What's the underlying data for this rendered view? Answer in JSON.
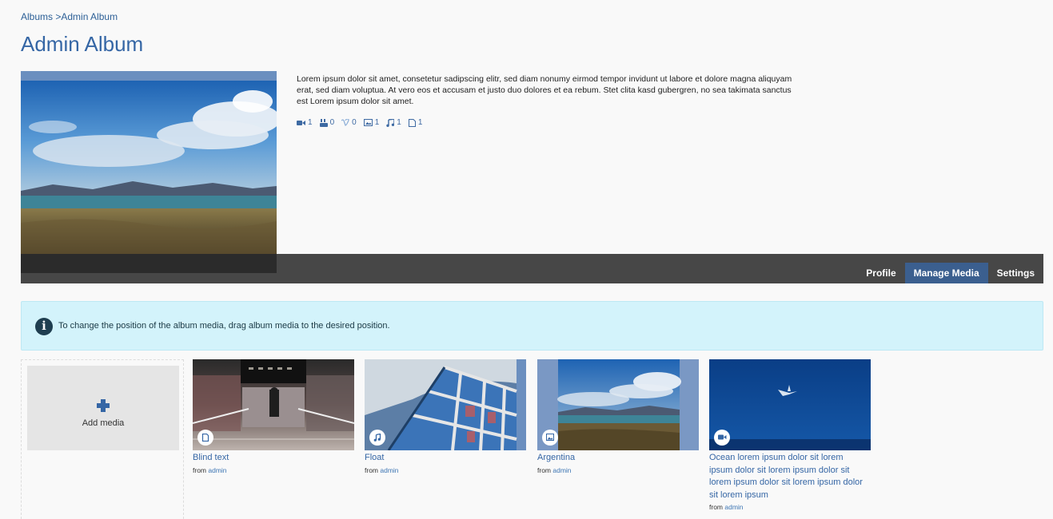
{
  "breadcrumb": {
    "albums_link": "Albums",
    "separator": " >",
    "current": "Admin Album"
  },
  "page_title": "Admin Album",
  "album": {
    "description": "Lorem ipsum dolor sit amet, consetetur sadipscing elitr, sed diam nonumy eirmod tempor invidunt ut labore et dolore magna aliquyam erat, sed diam voluptua. At vero eos et accusam et justo duo dolores et ea rebum. Stet clita kasd gubergren, no sea takimata sanctus est Lorem ipsum dolor sit amet.",
    "stats": {
      "video": "1",
      "youtube": "0",
      "vimeo": "0",
      "image": "1",
      "audio": "1",
      "document": "1"
    }
  },
  "tabs": [
    {
      "label": "Profile",
      "active": false
    },
    {
      "label": "Manage Media",
      "active": true
    },
    {
      "label": "Settings",
      "active": false
    }
  ],
  "alert": {
    "text": "To change the position of the album media, drag album media to the desired position."
  },
  "add_media": {
    "label": "Add media"
  },
  "media": [
    {
      "title": "Blind text",
      "from_label": "from",
      "author": "admin",
      "type_icon": "document-icon"
    },
    {
      "title": "Float",
      "from_label": "from",
      "author": "admin",
      "type_icon": "music-icon"
    },
    {
      "title": "Argentina",
      "from_label": "from",
      "author": "admin",
      "type_icon": "image-icon"
    },
    {
      "title": "Ocean lorem ipsum dolor sit lorem ipsum dolor sit lorem ipsum dolor sit lorem ipsum dolor sit lorem ipsum dolor sit lorem ipsum",
      "from_label": "from",
      "author": "admin",
      "type_icon": "video-icon"
    }
  ],
  "colors": {
    "accent": "#3566a5",
    "bar": "#474747",
    "active_tab": "#3b5f8f",
    "alert_bg": "#d3f3fb"
  }
}
